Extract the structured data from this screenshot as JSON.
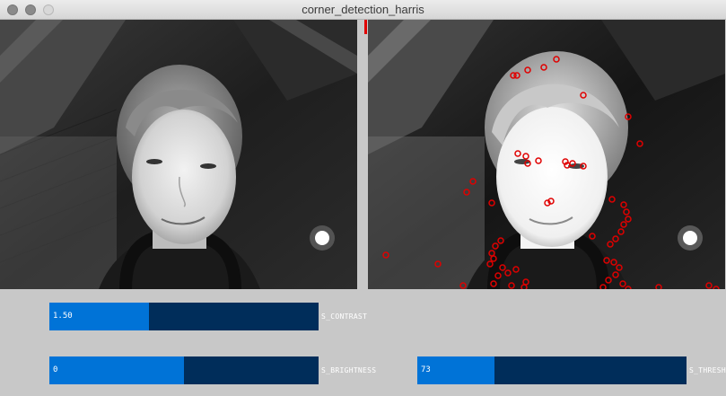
{
  "window": {
    "title": "corner_detection_harris"
  },
  "panels": {
    "left": {
      "name": "grayscale-camera-view"
    },
    "right": {
      "name": "harris-corner-overlay-view",
      "marker_color": "#e00000"
    }
  },
  "controls": [
    {
      "id": "contrast",
      "label": "S_CONTRAST",
      "value": "1.50",
      "fill_fraction": 0.37
    },
    {
      "id": "brightness",
      "label": "S_BRIGHTNESS",
      "value": "0",
      "fill_fraction": 0.5
    },
    {
      "id": "thresh",
      "label": "S_THRESH",
      "value": "73",
      "fill_fraction": 0.285
    }
  ],
  "colors": {
    "slider_track": "#002d5a",
    "slider_fill": "#0073d7",
    "background": "#c8c8c8",
    "corner_marker": "#e00000"
  }
}
